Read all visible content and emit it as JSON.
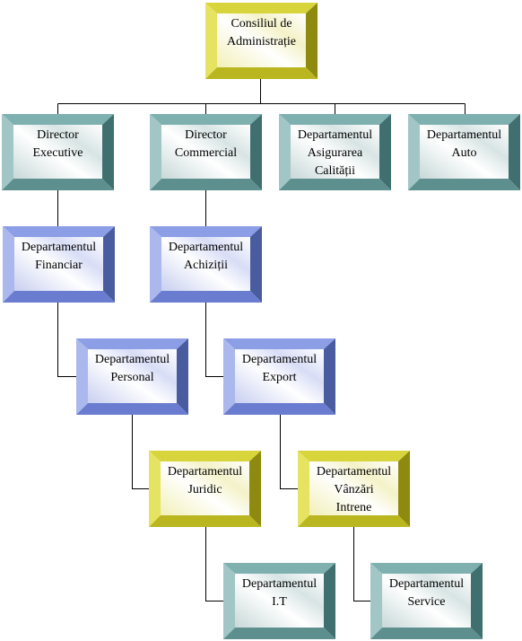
{
  "colors": {
    "teal": {
      "top": "#7fb0b0",
      "left": "#a2c6c6",
      "right": "#3f6f6f",
      "bottom": "#5e8f8f"
    },
    "blue": {
      "top": "#8c9ee6",
      "left": "#aab8ee",
      "right": "#4a5ca0",
      "bottom": "#6a7cd0"
    },
    "yellow": {
      "top": "#d8d43c",
      "left": "#e6e262",
      "right": "#8e8a10",
      "bottom": "#bab620"
    },
    "connector": "#000000"
  },
  "nodes": [
    {
      "id": "consiliul",
      "theme": "yellow",
      "lines": [
        "Consiliul de",
        "Administrație"
      ]
    },
    {
      "id": "director-executive",
      "theme": "teal",
      "lines": [
        "Director",
        "Executive"
      ]
    },
    {
      "id": "director-commercial",
      "theme": "teal",
      "lines": [
        "Director",
        "Commercial"
      ]
    },
    {
      "id": "asigurarea-calitatii",
      "theme": "teal",
      "lines": [
        "Departamentul",
        "Asigurarea",
        "Calității"
      ]
    },
    {
      "id": "auto",
      "theme": "teal",
      "lines": [
        "Departamentul",
        "Auto"
      ]
    },
    {
      "id": "financiar",
      "theme": "blue",
      "lines": [
        "Departamentul",
        "Financiar"
      ]
    },
    {
      "id": "achizitii",
      "theme": "blue",
      "lines": [
        "Departamentul",
        "Achiziții"
      ]
    },
    {
      "id": "personal",
      "theme": "blue",
      "lines": [
        "Departamentul",
        "Personal"
      ]
    },
    {
      "id": "export",
      "theme": "blue",
      "lines": [
        "Departamentul",
        "Export"
      ]
    },
    {
      "id": "juridic",
      "theme": "yellow",
      "lines": [
        "Departamentul",
        "Juridic"
      ]
    },
    {
      "id": "vanzari-intrene",
      "theme": "yellow",
      "lines": [
        "Departamentul",
        "Vânzări",
        "Intrene"
      ]
    },
    {
      "id": "it",
      "theme": "teal",
      "lines": [
        "Departamentul",
        "I.T"
      ]
    },
    {
      "id": "service",
      "theme": "teal",
      "lines": [
        "Departamentul",
        "Service"
      ]
    }
  ],
  "edges": [
    [
      "consiliul",
      "director-executive"
    ],
    [
      "consiliul",
      "director-commercial"
    ],
    [
      "consiliul",
      "asigurarea-calitatii"
    ],
    [
      "consiliul",
      "auto"
    ],
    [
      "director-executive",
      "financiar"
    ],
    [
      "director-commercial",
      "achizitii"
    ],
    [
      "financiar",
      "personal"
    ],
    [
      "achizitii",
      "export"
    ],
    [
      "personal",
      "juridic"
    ],
    [
      "export",
      "vanzari-intrene"
    ],
    [
      "juridic",
      "it"
    ],
    [
      "vanzari-intrene",
      "service"
    ]
  ]
}
